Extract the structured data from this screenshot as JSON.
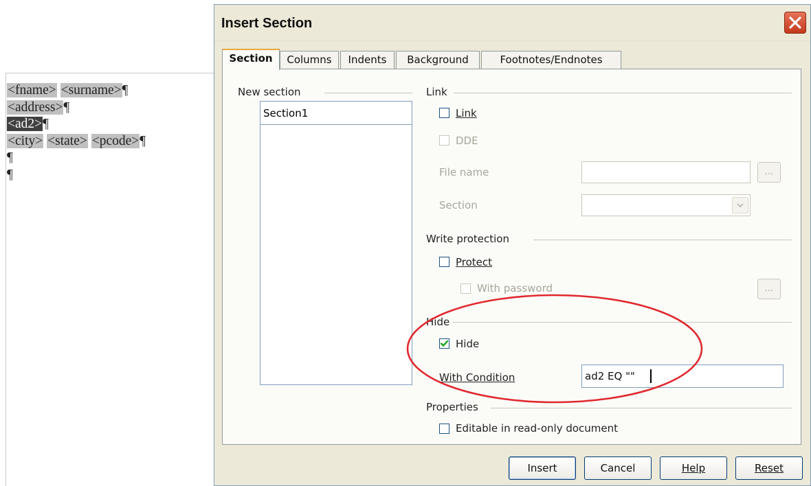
{
  "document": {
    "lines": [
      {
        "parts": [
          "<fname>",
          "<surname>"
        ]
      },
      {
        "parts": [
          "<address>"
        ]
      },
      {
        "parts": [
          "<ad2>"
        ]
      },
      {
        "parts": [
          "<city>",
          "<state>",
          "<pcode>"
        ]
      },
      {
        "parts": []
      },
      {
        "parts": []
      }
    ],
    "pilcrow": "¶"
  },
  "dialog": {
    "title": "Insert Section",
    "tabs": [
      "Section",
      "Columns",
      "Indents",
      "Background",
      "Footnotes/Endnotes"
    ],
    "active_tab": "Section",
    "new_section": {
      "label": "New section",
      "name_value": "Section1"
    },
    "link": {
      "group_label": "Link",
      "link_label": "Link",
      "link_checked": false,
      "dde_label": "DDE",
      "file_name_label": "File name",
      "file_name_value": "",
      "browse_label": "...",
      "section_label": "Section",
      "section_value": ""
    },
    "write_protection": {
      "group_label": "Write protection",
      "protect_label": "Protect",
      "protect_checked": false,
      "with_password_label": "With password",
      "password_button_label": "..."
    },
    "hide": {
      "group_label": "Hide",
      "hide_label": "Hide",
      "hide_checked": true,
      "condition_label": "With Condition",
      "condition_value": "ad2 EQ \"\""
    },
    "properties": {
      "group_label": "Properties",
      "editable_label": "Editable in read-only document",
      "editable_checked": false
    },
    "buttons": {
      "insert": "Insert",
      "cancel": "Cancel",
      "help": "Help",
      "reset": "Reset"
    },
    "colors": {
      "annotation_circle": "#e0282e",
      "checkbox_tick": "#21a121",
      "tab_highlight": "#e6a93c"
    }
  }
}
